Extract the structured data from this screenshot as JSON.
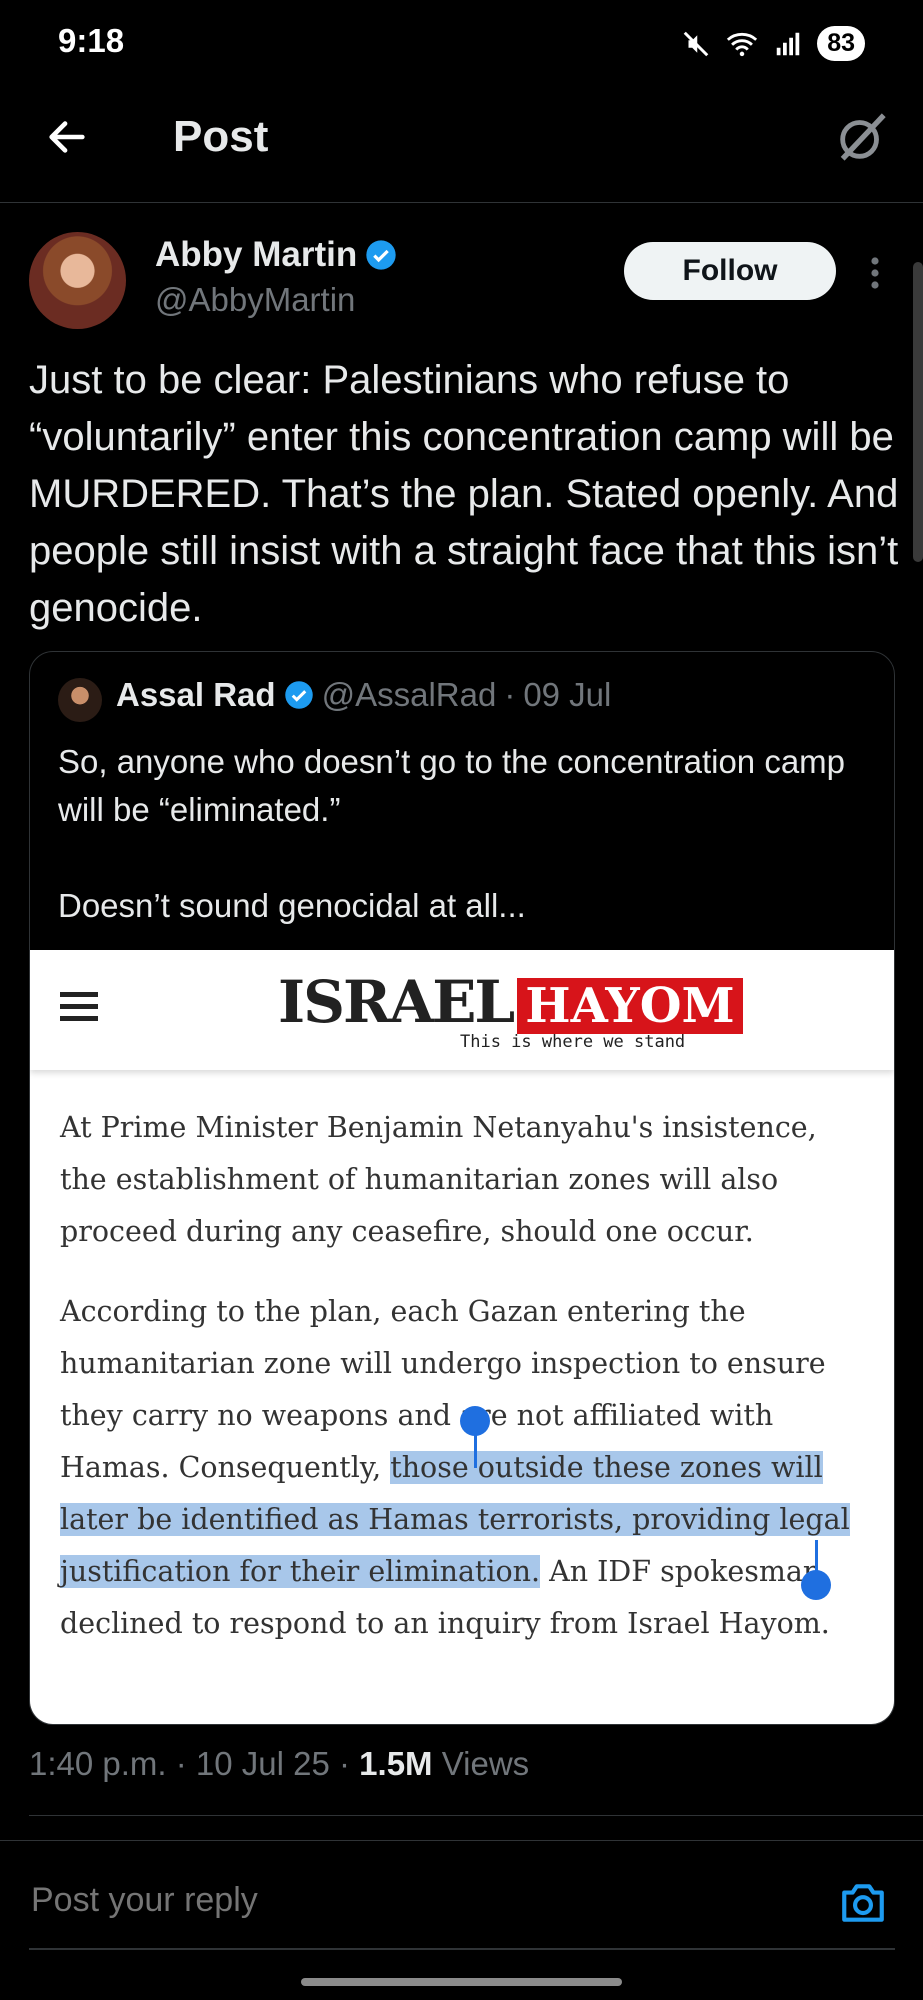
{
  "status_bar": {
    "time": "9:18",
    "battery": "83"
  },
  "header": {
    "title": "Post"
  },
  "post": {
    "author_name": "Abby Martin",
    "author_handle": "@AbbyMartin",
    "follow_label": "Follow",
    "text": "Just to be clear: Palestinians who refuse to “voluntarily” enter this concentration camp will be MURDERED. That’s the plan. Stated openly. And people still insist with a straight face that this isn’t genocide.",
    "time": "1:40 p.m.",
    "date": "10 Jul 25",
    "views_count": "1.5M",
    "views_label": "Views"
  },
  "quote": {
    "author_name": "Assal Rad",
    "author_handle": "@AssalRad",
    "date": "09 Jul",
    "text_line1": "So, anyone who doesn’t go to the concentration camp will be “eliminated.”",
    "text_line2": "Doesn’t sound genocidal at all...",
    "article": {
      "logo_israel": "ISRAEL",
      "logo_hayom": "HAYOM",
      "logo_tagline": "This is where we stand",
      "para1": "At Prime Minister Benjamin Netanyahu's insistence, the establishment of humanitarian zones will also proceed during any ceasefire, should one occur.",
      "para2_before": "According to the plan, each Gazan entering the humanitarian zone will undergo inspection to ensure they carry no weapons and are not affiliated with Hamas. Consequently, ",
      "para2_highlight": "those outside these zones will later be identified as Hamas terrorists, providing legal justification for their elimination.",
      "para2_after": " An IDF spokesman declined to respond to an inquiry from Israel Hayom."
    }
  },
  "reply": {
    "placeholder": "Post your reply"
  },
  "colors": {
    "verified": "#1d9bf0",
    "logo_red": "#d7141a",
    "highlight": "#a8c7ea",
    "selection_handle": "#1f6fe0"
  }
}
